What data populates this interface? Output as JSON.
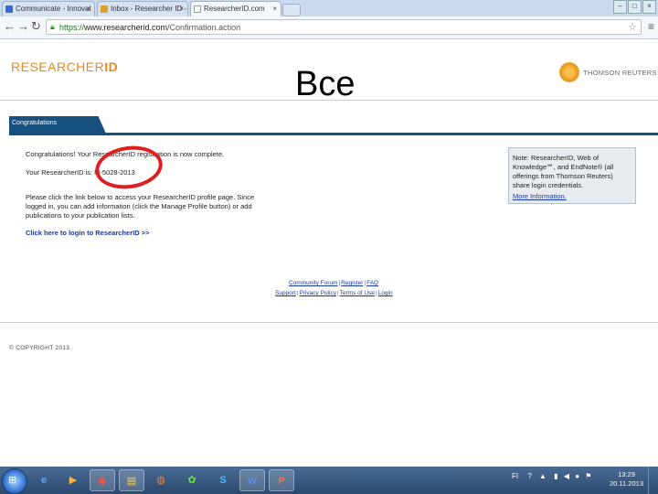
{
  "browser": {
    "tabs": [
      {
        "label": "Communicate - Innovat",
        "close": "×",
        "favicon_color": "#3b6cc4"
      },
      {
        "label": "Inbox - Researcher ID - I",
        "close": "×",
        "favicon_color": "#e0a030"
      },
      {
        "label": "ResearcherID.com",
        "close": "×",
        "favicon_color": "#ffffff"
      }
    ],
    "window_buttons": [
      "–",
      "□",
      "×"
    ],
    "url_scheme": "https://",
    "url_host": "www.researcherid.com",
    "url_path": "/Confirmation.action"
  },
  "page": {
    "logo_prefix": "RESEARCHER",
    "logo_suffix": "ID",
    "overlay_word": "Все",
    "partner_logo_text": "THOMSON REUTERS",
    "section_tab": "Congratulations",
    "message_line1": "Congratulations! Your ResearcherID registration is now complete.",
    "message_line2": "Your ResearcherID is: M-5028-2013",
    "message_para": [
      "Please click the link below to access your ResearcherID profile page. Since",
      "logged in, you can add information (click the Manage Profile button) or add",
      "publications to your publication lists."
    ],
    "login_link": "Click here to login to ResearcherID >>",
    "note": {
      "text_lines": [
        "Note: ResearcherID, Web of",
        "Knowledge℠, and EndNote® (all",
        "offerings from Thomson Reuters)",
        "share login credentials."
      ],
      "more": "More Information."
    },
    "footer_links_row1": [
      "Community Forum",
      "Register",
      "FAQ"
    ],
    "footer_links_row2": [
      "Support",
      "Privacy Policy",
      "Terms of Use",
      "Login"
    ],
    "copyright": "© COPYRIGHT 2013"
  },
  "taskbar": {
    "start_icon": "windows-logo-icon",
    "apps": [
      {
        "name": "ie-icon",
        "glyph": "e"
      },
      {
        "name": "media-player-icon",
        "glyph": "▶"
      },
      {
        "name": "chrome-icon",
        "glyph": "◉"
      },
      {
        "name": "explorer-icon",
        "glyph": "▤"
      },
      {
        "name": "firefox-icon",
        "glyph": "◍"
      },
      {
        "name": "icq-icon",
        "glyph": "✿"
      },
      {
        "name": "skype-icon",
        "glyph": "S"
      },
      {
        "name": "word-icon",
        "glyph": "W"
      },
      {
        "name": "powerpoint-icon",
        "glyph": "P"
      }
    ],
    "lang": "FI",
    "time": "13:29",
    "date": "20.11.2013"
  }
}
